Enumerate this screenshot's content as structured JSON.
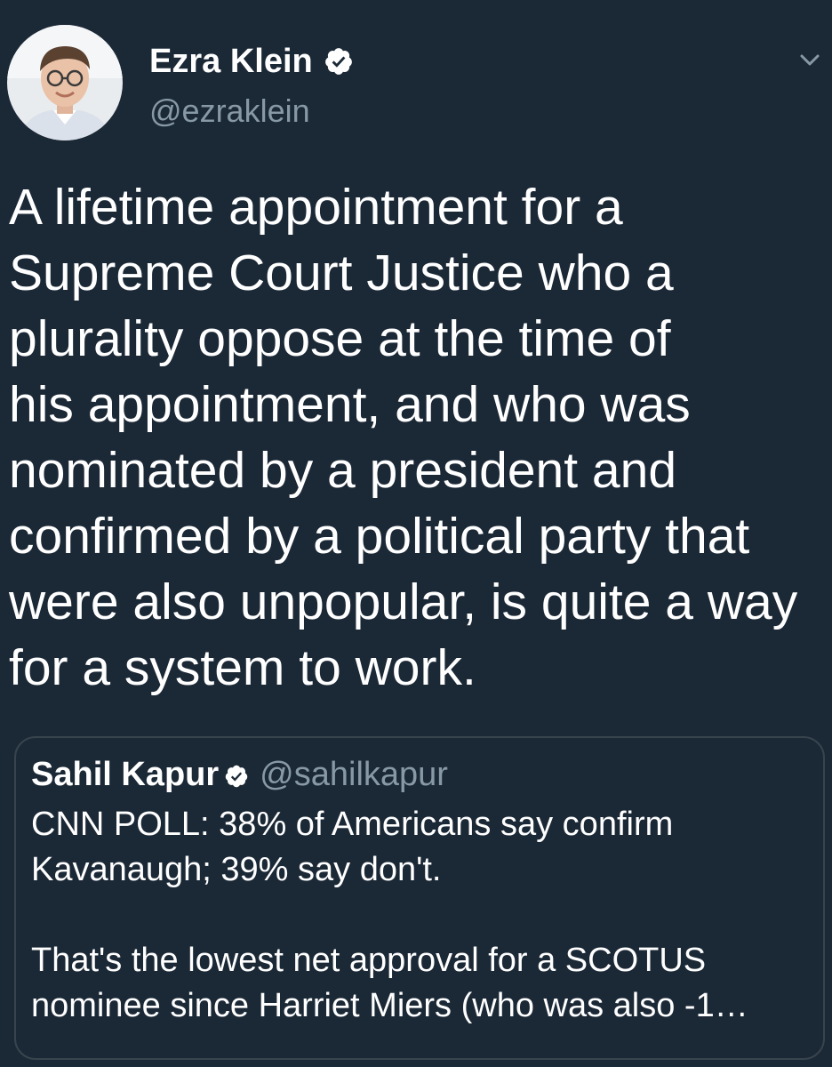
{
  "tweet": {
    "display_name": "Ezra Klein",
    "handle": "@ezraklein",
    "text": "A lifetime appointment for a\nSupreme Court Justice who a\nplurality oppose at the time of\nhis appointment, and who was\nnominated by a president and\nconfirmed by a political party that\nwere also unpopular, is quite a way\nfor a system to work."
  },
  "quoted_tweet": {
    "display_name": "Sahil Kapur",
    "handle": "@sahilkapur",
    "text": "CNN POLL: 38% of Americans say confirm\nKavanaugh; 39% say don't.\n\nThat's the lowest net approval for a SCOTUS\nnominee since Harriet Miers (who was also -1…"
  },
  "icons": {
    "verified": "verified-badge-icon",
    "menu": "chevron-down-icon"
  },
  "colors": {
    "background": "#1b2836",
    "text": "#ffffff",
    "secondary_text": "#8899a6",
    "quote_border": "#38444d"
  }
}
